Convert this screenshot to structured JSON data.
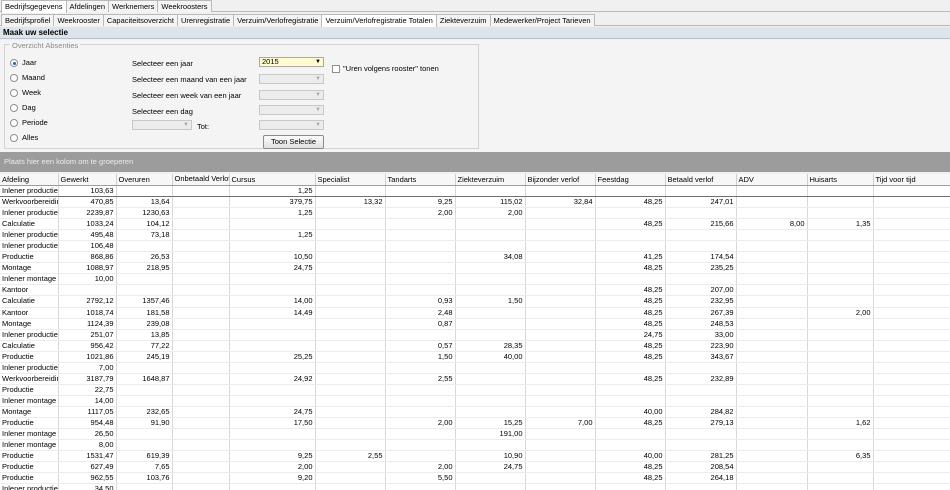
{
  "top_tabs": [
    "Bedrijfsgegevens",
    "Afdelingen",
    "Werknemers",
    "Weekroosters"
  ],
  "sub_tabs": [
    {
      "label": "Bedrijfsprofiel",
      "active": false
    },
    {
      "label": "Weekrooster",
      "active": false
    },
    {
      "label": "Capaciteitsoverzicht",
      "active": false
    },
    {
      "label": "Urenregistratie",
      "active": false
    },
    {
      "label": "Verzuim/Verlofregistratie",
      "active": false
    },
    {
      "label": "Verzuim/Verlofregistratie Totalen",
      "active": true
    },
    {
      "label": "Ziekteverzuim",
      "active": false
    },
    {
      "label": "Medewerker/Project Tarieven",
      "active": false
    }
  ],
  "panel_title": "Maak uw selectie",
  "filter": {
    "group_title": "Overzicht Absenties",
    "radios": [
      {
        "label": "Jaar",
        "checked": true
      },
      {
        "label": "Maand",
        "checked": false
      },
      {
        "label": "Week",
        "checked": false
      },
      {
        "label": "Dag",
        "checked": false
      },
      {
        "label": "Periode",
        "checked": false
      },
      {
        "label": "Alles",
        "checked": false
      }
    ],
    "year_label": "Selecteer een jaar",
    "year_value": "2015",
    "month_label": "Selecteer een maand van een jaar",
    "week_label": "Selecteer een week van een jaar",
    "day_label": "Selecteer een dag",
    "tot_label": "Tot:",
    "checkbox_label": "\"Uren volgens rooster\" tonen",
    "button_label": "Toon Selectie"
  },
  "group_bar_text": "Plaats hier een kolom om te groeperen",
  "columns": [
    "Afdeling",
    "Gewerkt",
    "Overuren",
    "Onbetaald Verlof",
    "Cursus",
    "Specialist",
    "Tandarts",
    "Ziekteverzuim",
    "Bijzonder verlof",
    "Feestdag",
    "Betaald verlof",
    "ADV",
    "Huisarts",
    "Tijd voor tijd"
  ],
  "rows": [
    [
      "Inlener productie",
      "103,63",
      "",
      "",
      "1,25",
      "",
      "",
      "",
      "",
      "",
      "",
      "",
      "",
      ""
    ],
    [
      "Werkvoorbereiding",
      "470,85",
      "13,64",
      "",
      "379,75",
      "13,32",
      "9,25",
      "115,02",
      "32,84",
      "48,25",
      "247,01",
      "",
      "",
      ""
    ],
    [
      "Inlener productie",
      "2239,87",
      "1230,63",
      "",
      "1,25",
      "",
      "2,00",
      "2,00",
      "",
      "",
      "",
      "",
      "",
      ""
    ],
    [
      "Calculatie",
      "1033,24",
      "104,12",
      "",
      "",
      "",
      "",
      "",
      "",
      "48,25",
      "215,66",
      "8,00",
      "1,35",
      ""
    ],
    [
      "Inlener productie",
      "495,48",
      "73,18",
      "",
      "1,25",
      "",
      "",
      "",
      "",
      "",
      "",
      "",
      "",
      ""
    ],
    [
      "Inlener productie",
      "106,48",
      "",
      "",
      "",
      "",
      "",
      "",
      "",
      "",
      "",
      "",
      "",
      ""
    ],
    [
      "Productie",
      "868,86",
      "26,53",
      "",
      "10,50",
      "",
      "",
      "34,08",
      "",
      "41,25",
      "174,54",
      "",
      "",
      ""
    ],
    [
      "Montage",
      "1088,97",
      "218,95",
      "",
      "24,75",
      "",
      "",
      "",
      "",
      "48,25",
      "235,25",
      "",
      "",
      ""
    ],
    [
      "Inlener montage",
      "10,00",
      "",
      "",
      "",
      "",
      "",
      "",
      "",
      "",
      "",
      "",
      "",
      ""
    ],
    [
      "Kantoor",
      "",
      "",
      "",
      "",
      "",
      "",
      "",
      "",
      "48,25",
      "207,00",
      "",
      "",
      ""
    ],
    [
      "Calculatie",
      "2792,12",
      "1357,46",
      "",
      "14,00",
      "",
      "0,93",
      "1,50",
      "",
      "48,25",
      "232,95",
      "",
      "",
      ""
    ],
    [
      "Kantoor",
      "1018,74",
      "181,58",
      "",
      "14,49",
      "",
      "2,48",
      "",
      "",
      "48,25",
      "267,39",
      "",
      "2,00",
      ""
    ],
    [
      "Montage",
      "1124,39",
      "239,08",
      "",
      "",
      "",
      "0,87",
      "",
      "",
      "48,25",
      "248,53",
      "",
      "",
      ""
    ],
    [
      "Inlener productie",
      "251,07",
      "13,85",
      "",
      "",
      "",
      "",
      "",
      "",
      "24,75",
      "33,00",
      "",
      "",
      ""
    ],
    [
      "Calculatie",
      "956,42",
      "77,22",
      "",
      "",
      "",
      "0,57",
      "28,35",
      "",
      "48,25",
      "223,90",
      "",
      "",
      ""
    ],
    [
      "Productie",
      "1021,86",
      "245,19",
      "",
      "25,25",
      "",
      "1,50",
      "40,00",
      "",
      "48,25",
      "343,67",
      "",
      "",
      ""
    ],
    [
      "Inlener productie",
      "7,00",
      "",
      "",
      "",
      "",
      "",
      "",
      "",
      "",
      "",
      "",
      "",
      ""
    ],
    [
      "Werkvoorbereiding",
      "3187,79",
      "1648,87",
      "",
      "24,92",
      "",
      "2,55",
      "",
      "",
      "48,25",
      "232,89",
      "",
      "",
      ""
    ],
    [
      "Productie",
      "22,75",
      "",
      "",
      "",
      "",
      "",
      "",
      "",
      "",
      "",
      "",
      "",
      ""
    ],
    [
      "Inlener montage",
      "14,00",
      "",
      "",
      "",
      "",
      "",
      "",
      "",
      "",
      "",
      "",
      "",
      ""
    ],
    [
      "Montage",
      "1117,05",
      "232,65",
      "",
      "24,75",
      "",
      "",
      "",
      "",
      "40,00",
      "284,82",
      "",
      "",
      ""
    ],
    [
      "Productie",
      "954,48",
      "91,90",
      "",
      "17,50",
      "",
      "2,00",
      "15,25",
      "7,00",
      "48,25",
      "279,13",
      "",
      "1,62",
      ""
    ],
    [
      "Inlener montage",
      "26,50",
      "",
      "",
      "",
      "",
      "",
      "191,00",
      "",
      "",
      "",
      "",
      "",
      ""
    ],
    [
      "Inlener montage",
      "8,00",
      "",
      "",
      "",
      "",
      "",
      "",
      "",
      "",
      "",
      "",
      "",
      ""
    ],
    [
      "Productie",
      "1531,47",
      "619,39",
      "",
      "9,25",
      "2,55",
      "",
      "10,90",
      "",
      "40,00",
      "281,25",
      "",
      "6,35",
      ""
    ],
    [
      "Productie",
      "627,49",
      "7,65",
      "",
      "2,00",
      "",
      "2,00",
      "24,75",
      "",
      "48,25",
      "208,54",
      "",
      "",
      ""
    ],
    [
      "Productie",
      "962,55",
      "103,76",
      "",
      "9,20",
      "",
      "5,50",
      "",
      "",
      "48,25",
      "264,18",
      "",
      "",
      ""
    ],
    [
      "Inlener productie",
      "34,50",
      "",
      "",
      "",
      "",
      "",
      "",
      "",
      "",
      "",
      "",
      "",
      ""
    ]
  ]
}
